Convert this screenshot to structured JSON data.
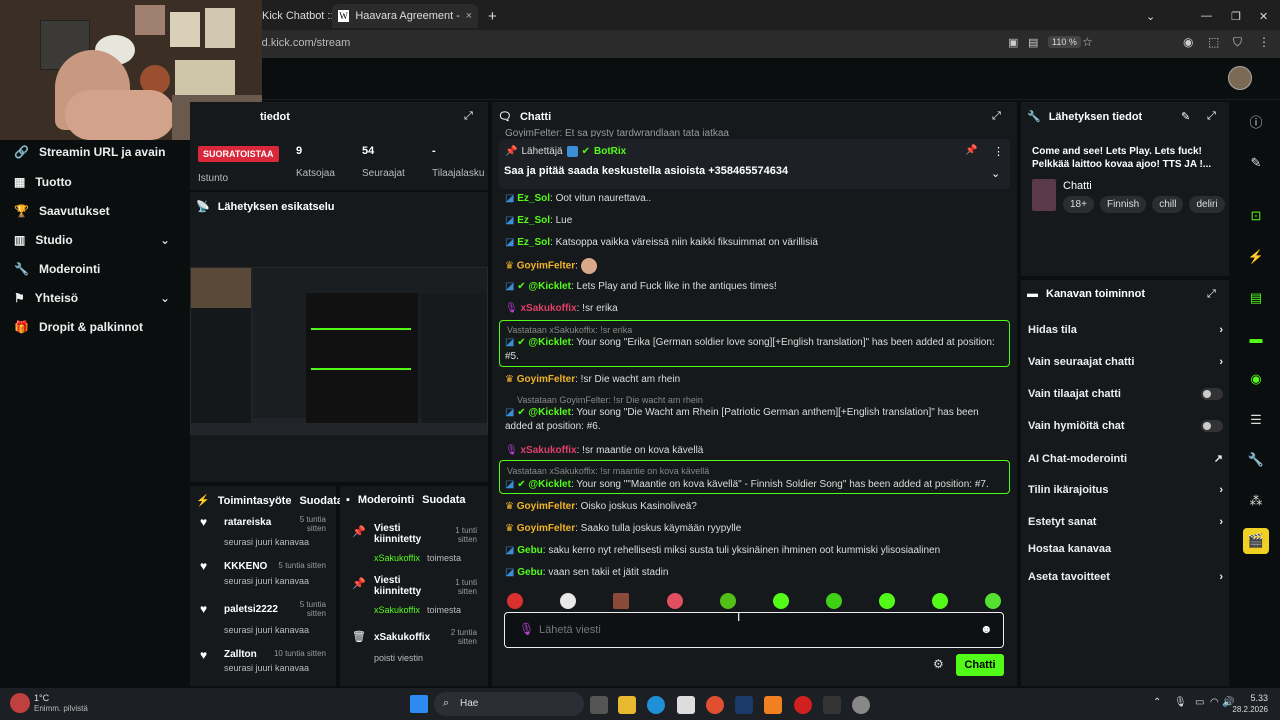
{
  "browser": {
    "tabs": [
      "Kick Chatbot ::",
      "Haavara Agreement - Wikipedia"
    ],
    "new_tab": "+",
    "url": "rd.kick.com/stream",
    "zoom": "110 %"
  },
  "sidebar": {
    "items": [
      {
        "label": "Streamin URL ja avain",
        "icon": "link-icon"
      },
      {
        "label": "Tuotto",
        "icon": "revenue-icon"
      },
      {
        "label": "Saavutukset",
        "icon": "trophy-icon"
      },
      {
        "label": "Studio",
        "icon": "studio-icon"
      },
      {
        "label": "Moderointi",
        "icon": "wrench-icon"
      },
      {
        "label": "Yhteisö",
        "icon": "community-icon"
      },
      {
        "label": "Dropit & palkinnot",
        "icon": "gift-icon"
      }
    ]
  },
  "stats": {
    "title": "tiedot",
    "live_badge": "SUORATOISTAA",
    "session_label": "Istunto",
    "viewers": "9",
    "viewers_label": "Katsojaa",
    "followers": "54",
    "followers_label": "Seuraajat",
    "subs": "-",
    "subs_label": "Tilaajalasku"
  },
  "preview": {
    "title": "Lähetyksen esikatselu"
  },
  "activity": {
    "title": "Toimintasyöte",
    "subtitle": "Suodata",
    "items": [
      {
        "name": "ratareiska",
        "time": "5 tuntia sitten",
        "text": "seurasi juuri kanavaa"
      },
      {
        "name": "KKKENO",
        "time": "5 tuntia sitten",
        "text": "seurasi juuri kanavaa"
      },
      {
        "name": "paletsi2222",
        "time": "5 tuntia sitten",
        "text": "seurasi juuri kanavaa"
      },
      {
        "name": "Zallton",
        "time": "10 tuntia sitten",
        "text": "seurasi juuri kanavaa"
      }
    ]
  },
  "moderation": {
    "title": "Moderointi",
    "subtitle": "Suodata",
    "items": [
      {
        "name": "Viesti kiinnitetty",
        "time": "1 tunti sitten",
        "who": "xSakukoffix",
        "action": "toimesta"
      },
      {
        "name": "Viesti kiinnitetty",
        "time": "1 tunti sitten",
        "who": "xSakukoffix",
        "action": "toimesta"
      },
      {
        "name": "xSakukoffix",
        "time": "2 tuntia sitten",
        "who": "",
        "action": "poisti viestin"
      }
    ]
  },
  "chat": {
    "title": "Chatti",
    "pinned_sender_label": "Lähettäjä",
    "pinned_sender": "BotRix",
    "pinned_text": "Saa ja pitää saada keskustella asioista +358465574634",
    "top_partial": "GoyimFelter: Et sa pysty tardwrandlaan tata iatkaa",
    "messages": [
      {
        "user": "Ez_Sol",
        "text": ": Oot vitun naurettava.."
      },
      {
        "user": "Ez_Sol",
        "text": ": Lue"
      },
      {
        "user": "Ez_Sol",
        "text": ": Katsoppa vaikka väreissä niin kaikki fiksuimmat on värillisiä"
      },
      {
        "user": "GoyimFelter",
        "text": ":"
      },
      {
        "user": "@Kicklet",
        "text": ": Lets Play and Fuck like in the antiques times!"
      },
      {
        "user": "xSakukoffix",
        "text": ": !sr erika"
      },
      {
        "reply": "Vastataan xSakukoffix: !sr erika",
        "user": "@Kicklet",
        "text": ": Your song \"Erika [German soldier love song][+English translation]\" has been added at position: #5."
      },
      {
        "user": "GoyimFelter",
        "text": ": !sr Die wacht am rhein"
      },
      {
        "reply": "Vastataan GoyimFelter: !sr Die wacht am rhein",
        "user": "@Kicklet",
        "text": ": Your song \"Die Wacht am Rhein [Patriotic German anthem][+English translation]\" has been added at position: #6."
      },
      {
        "user": "xSakukoffix",
        "text": ": !sr maantie on kova kävellä"
      },
      {
        "reply": "Vastataan xSakukoffix: !sr maantie on kova kävellä",
        "user": "@Kicklet",
        "text": ": Your song \"\"Maantie on kova kävellä\" - Finnish Soldier Song\" has been added at position: #7."
      },
      {
        "user": "GoyimFelter",
        "text": ": Oisko joskus Kasinoliveä?"
      },
      {
        "user": "GoyimFelter",
        "text": ": Saako tulla joskus käymään ryypylle"
      },
      {
        "user": "Gebu",
        "text": ": saku kerro nyt rehellisesti miksi susta tuli yksinäinen ihminen oot kummiski ylisosiaalinen"
      },
      {
        "user": "Gebu",
        "text": ": vaan sen takii et jätit stadin"
      }
    ],
    "input_placeholder": "Lähetä viesti",
    "send_label": "Chatti"
  },
  "stream_info": {
    "title": "Lähetyksen tiedot",
    "stream_title": "Come and see! Lets Play. Lets fuck! Pelkkää laittoo kovaa ajoo! TTS JA !...",
    "category": "Chatti",
    "tags": [
      "18+",
      "Finnish",
      "chill",
      "deliri"
    ]
  },
  "channel_actions": {
    "title": "Kanavan toiminnot",
    "items": [
      {
        "label": "Hidas tila",
        "control": "chevron"
      },
      {
        "label": "Vain seuraajat chatti",
        "control": "chevron"
      },
      {
        "label": "Vain tilaajat chatti",
        "control": "toggle"
      },
      {
        "label": "Vain hymiöitä chat",
        "control": "toggle"
      },
      {
        "label": "AI Chat-moderointi",
        "control": "external"
      },
      {
        "label": "Tilin ikärajoitus",
        "control": "chevron"
      },
      {
        "label": "Estetyt sanat",
        "control": "chevron"
      },
      {
        "label": "Hostaa kanavaa",
        "control": "none"
      },
      {
        "label": "Aseta tavoitteet",
        "control": "chevron"
      }
    ]
  },
  "taskbar": {
    "weather_temp": "1°C",
    "weather_text": "Enimm. pilvistä",
    "search": "Hae",
    "time": "5.33",
    "date": "28.2.2026"
  }
}
